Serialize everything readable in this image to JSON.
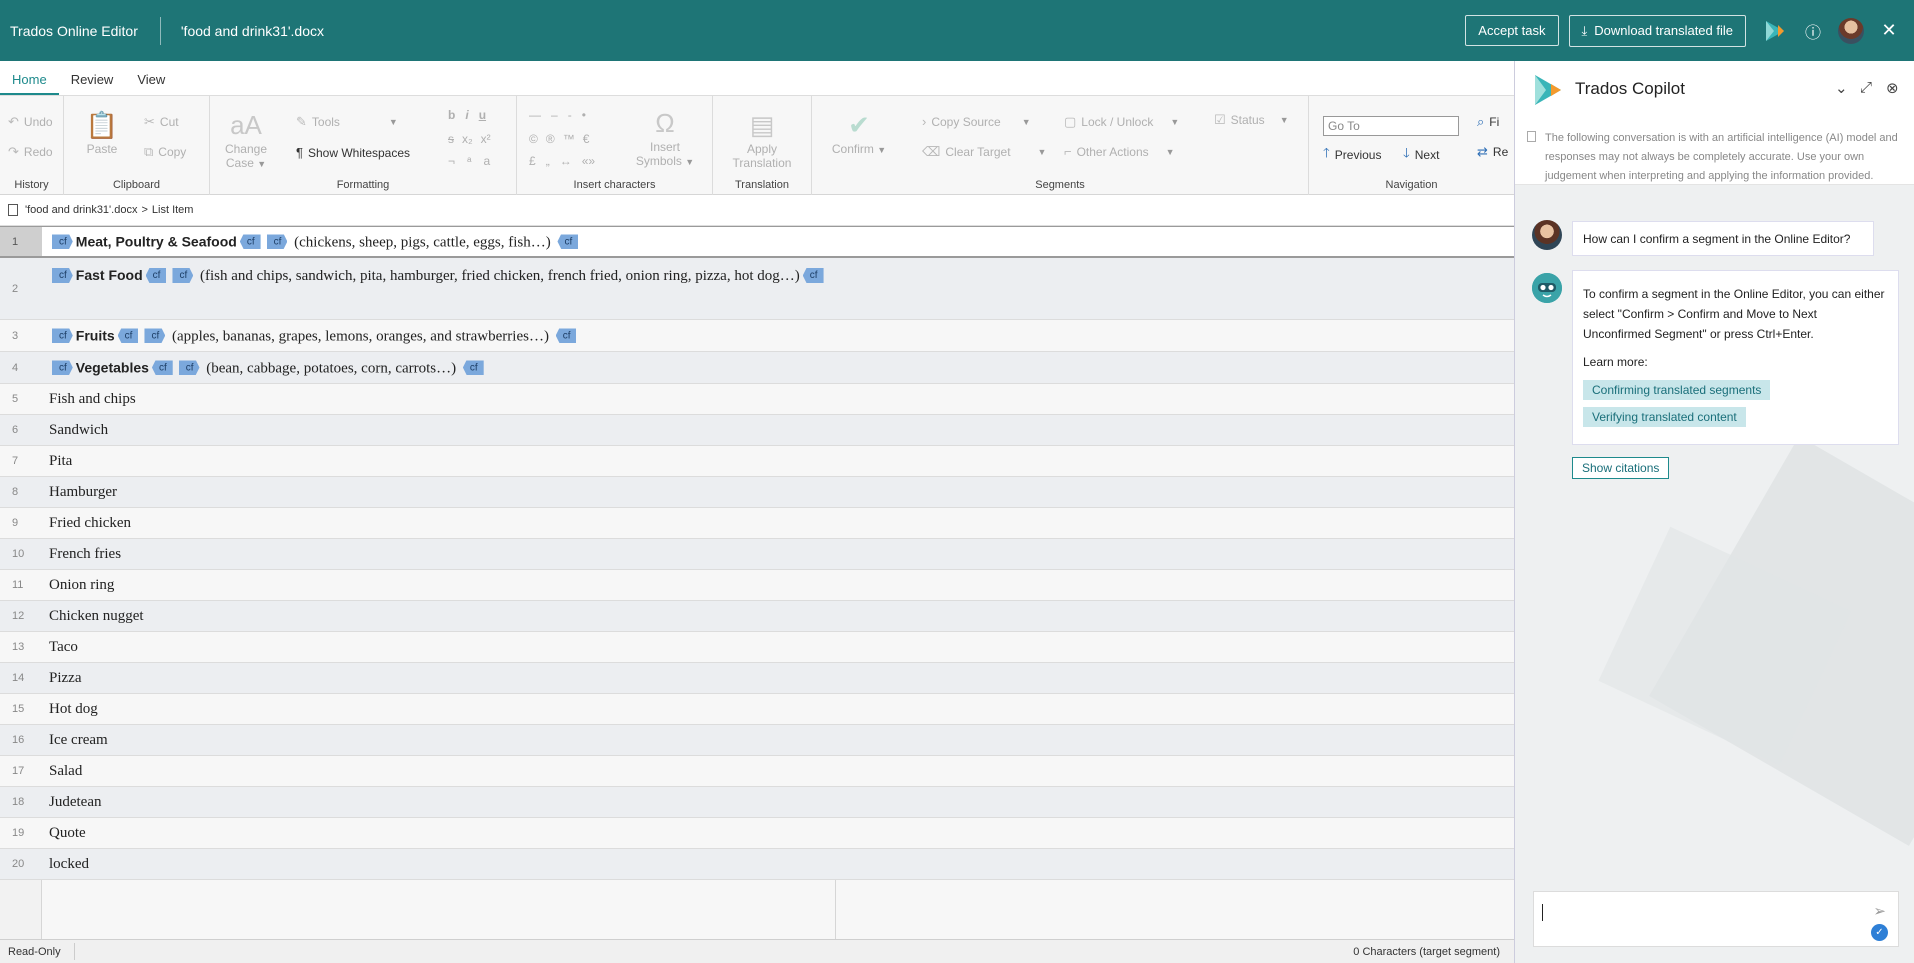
{
  "topbar": {
    "app_title": "Trados Online Editor",
    "doc_title": "'food and drink31'.docx",
    "accept_task": "Accept task",
    "download": "Download translated file"
  },
  "tabs": [
    "Home",
    "Review",
    "View"
  ],
  "ribbon": {
    "history": {
      "label": "History",
      "undo": "Undo",
      "redo": "Redo"
    },
    "clipboard": {
      "label": "Clipboard",
      "paste": "Paste",
      "cut": "Cut",
      "copy": "Copy"
    },
    "formatting": {
      "label": "Formatting",
      "change_case": "Change Case",
      "tools": "Tools",
      "show_whitespaces": "Show Whitespaces"
    },
    "insert_characters": {
      "label": "Insert characters",
      "insert_symbols": "Insert Symbols"
    },
    "translation": {
      "label": "Translation",
      "apply_translation": "Apply Translation"
    },
    "segments": {
      "label": "Segments",
      "confirm": "Confirm",
      "copy_source": "Copy Source",
      "clear_target": "Clear Target",
      "lock_unlock": "Lock / Unlock",
      "other_actions": "Other Actions",
      "status": "Status"
    },
    "navigation": {
      "label": "Navigation",
      "goto_placeholder": "Go To",
      "previous": "Previous",
      "next": "Next",
      "find": "Fi",
      "replace": "Re"
    }
  },
  "breadcrumb": {
    "file": "'food and drink31'.docx",
    "sep": ">",
    "item": "List Item"
  },
  "segments": [
    {
      "n": "1",
      "tag_only": false,
      "parts": [
        "Meat, Poultry & Seafood",
        "(chickens, sheep, pigs, cattle, eggs, fish…)"
      ]
    },
    {
      "n": "2",
      "parts": [
        "Fast Food",
        "(fish and chips, sandwich, pita, hamburger, fried chicken, french fried, onion ring, pizza, hot",
        "dog…)"
      ]
    },
    {
      "n": "3",
      "parts": [
        "Fruits",
        "(apples, bananas, grapes, lemons, oranges, and strawberries…)"
      ]
    },
    {
      "n": "4",
      "parts": [
        "Vegetables",
        "(bean, cabbage, potatoes, corn, carrots…)"
      ]
    },
    {
      "n": "5",
      "text": "Fish and chips"
    },
    {
      "n": "6",
      "text": "Sandwich"
    },
    {
      "n": "7",
      "text": "Pita"
    },
    {
      "n": "8",
      "text": "Hamburger"
    },
    {
      "n": "9",
      "text": "Fried chicken"
    },
    {
      "n": "10",
      "text": "French fries"
    },
    {
      "n": "11",
      "text": "Onion ring"
    },
    {
      "n": "12",
      "text": "Chicken nugget"
    },
    {
      "n": "13",
      "text": "Taco"
    },
    {
      "n": "14",
      "text": "Pizza"
    },
    {
      "n": "15",
      "text": "Hot dog"
    },
    {
      "n": "16",
      "text": "Ice cream"
    },
    {
      "n": "17",
      "text": "Salad"
    },
    {
      "n": "18",
      "text": "Judetean"
    },
    {
      "n": "19",
      "text": "Quote"
    },
    {
      "n": "20",
      "text": "locked"
    }
  ],
  "tag_label": "cf",
  "status": {
    "mode": "Read-Only",
    "chars": "0 Characters (target segment)"
  },
  "copilot": {
    "title": "Trados Copilot",
    "notice": "The following conversation is with an artificial intelligence (AI) model and responses may not always be completely accurate. Use your own judgement when interpreting and applying the information provided.",
    "user_message": "How can I confirm a segment in the Online Editor?",
    "bot_message": "To confirm a segment in the Online Editor, you can either select \"Confirm > Confirm and Move to Next Unconfirmed Segment\" or press Ctrl+Enter.",
    "learn_more": "Learn more:",
    "link1": "Confirming translated segments",
    "link2": "Verifying translated content",
    "show_citations": "Show citations"
  },
  "colors": {
    "topbar": "#1e7576",
    "accent": "#1e8a8c",
    "tag": "#7ba8dc"
  }
}
